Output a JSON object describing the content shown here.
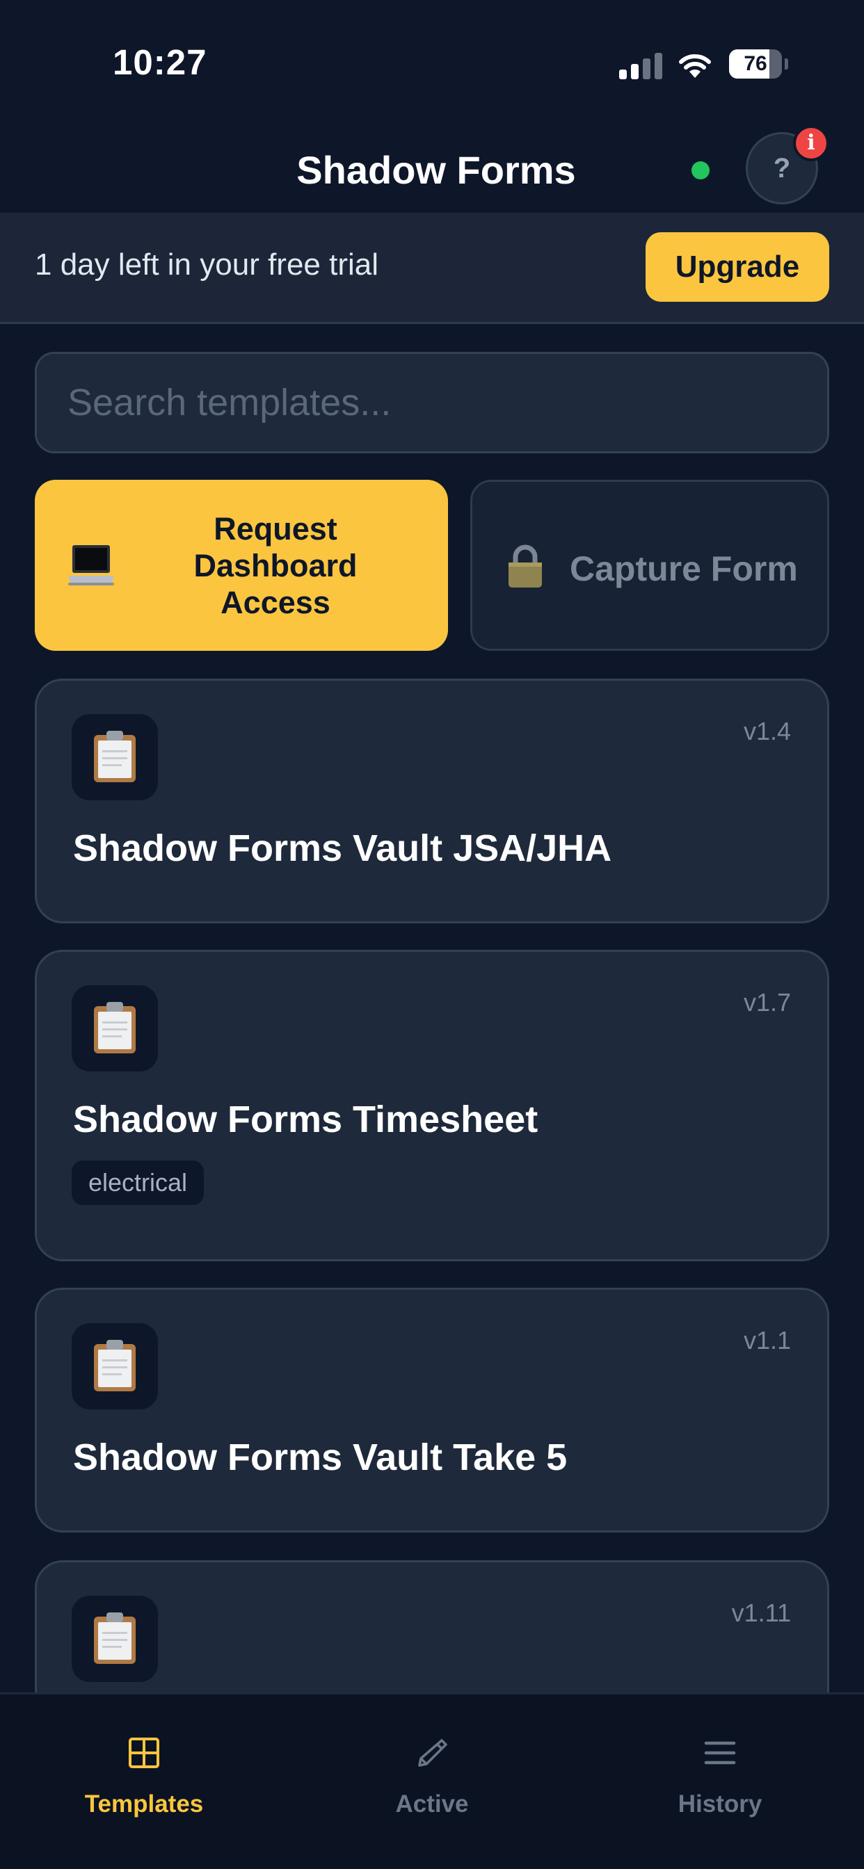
{
  "status_bar": {
    "time": "10:27",
    "battery": "76",
    "battery_level": 0.76
  },
  "header": {
    "title": "Shadow Forms",
    "help_label": "?",
    "badge_label": "i"
  },
  "trial_banner": {
    "message": "1 day left in your free trial",
    "upgrade_label": "Upgrade"
  },
  "search": {
    "placeholder": "Search templates...",
    "value": ""
  },
  "actions": {
    "dashboard_label": "Request Dashboard Access",
    "dashboard_icon": "laptop-icon",
    "capture_label": "Capture Form",
    "capture_icon": "lock-icon"
  },
  "templates": [
    {
      "title": "Shadow Forms Vault JSA/JHA",
      "version": "v1.4",
      "tag": "",
      "icon": "clipboard-icon"
    },
    {
      "title": "Shadow Forms Timesheet",
      "version": "v1.7",
      "tag": "electrical",
      "icon": "clipboard-icon"
    },
    {
      "title": "Shadow Forms Vault Take 5",
      "version": "v1.1",
      "tag": "",
      "icon": "clipboard-icon"
    },
    {
      "title": "",
      "version": "v1.11",
      "tag": "",
      "icon": "clipboard-icon"
    }
  ],
  "tabs": [
    {
      "label": "Templates",
      "icon": "grid-icon",
      "active": true
    },
    {
      "label": "Active",
      "icon": "pencil-icon",
      "active": false
    },
    {
      "label": "History",
      "icon": "list-icon",
      "active": false
    }
  ],
  "colors": {
    "background": "#0e1729",
    "accent": "#fbc53f",
    "card": "#1e293b",
    "online": "#22c55e",
    "badge": "#ef4444",
    "inactive_tab": "#6b7689"
  }
}
